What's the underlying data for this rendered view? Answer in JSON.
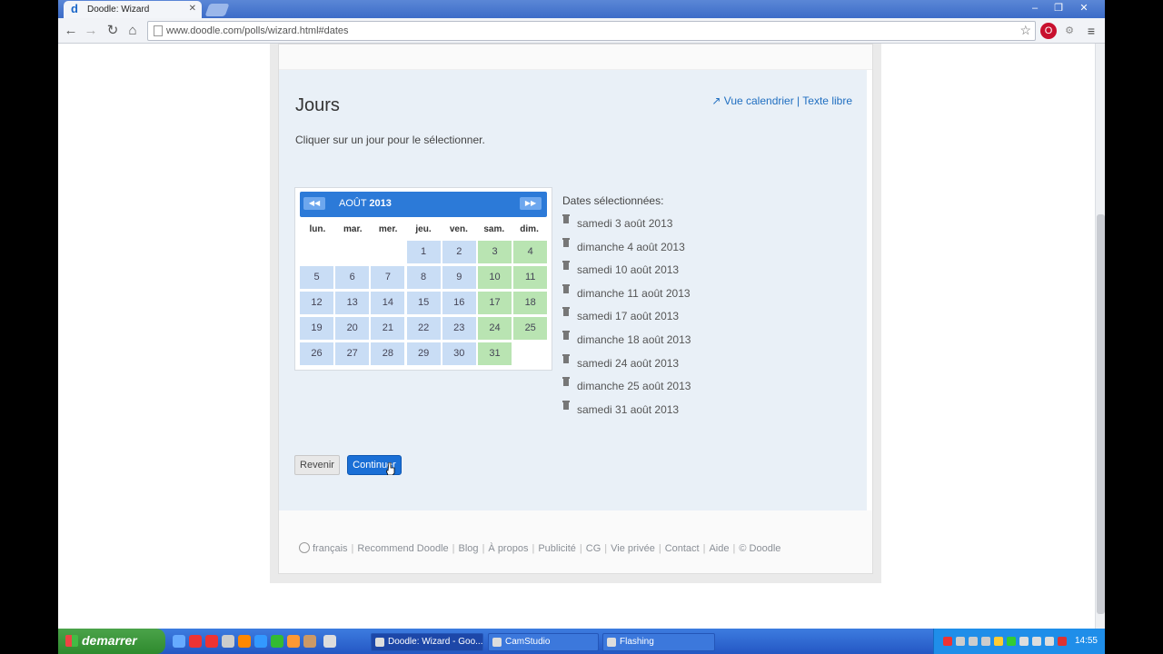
{
  "browser": {
    "tab_title": "Doodle: Wizard",
    "tab_favicon": "d",
    "url": "www.doodle.com/polls/wizard.html#dates",
    "window_controls": [
      "minimize-icon",
      "restore-icon",
      "close-icon"
    ]
  },
  "wizard": {
    "title": "Jours",
    "link_calendar": "Vue calendrier",
    "link_separator": "|",
    "link_text": "Texte libre",
    "instructions": "Cliquer sur un jour pour le sélectionner.",
    "calendar": {
      "month": "AOÛT",
      "year": "2013",
      "weekdays": [
        "lun.",
        "mar.",
        "mer.",
        "jeu.",
        "ven.",
        "sam.",
        "dim."
      ],
      "rows": [
        [
          null,
          null,
          null,
          1,
          2,
          3,
          4
        ],
        [
          5,
          6,
          7,
          8,
          9,
          10,
          11
        ],
        [
          12,
          13,
          14,
          15,
          16,
          17,
          18
        ],
        [
          19,
          20,
          21,
          22,
          23,
          24,
          25
        ],
        [
          26,
          27,
          28,
          29,
          30,
          31,
          null
        ]
      ],
      "selected_days": [
        3,
        4,
        10,
        11,
        17,
        18,
        24,
        25,
        31
      ],
      "colors": {
        "header": "#2c7ad8",
        "day": "#c9ddf5",
        "selected_day": "#b9e4b2"
      }
    },
    "selected_title": "Dates sélectionnées:",
    "selected_dates": [
      "samedi 3 août 2013",
      "dimanche 4 août 2013",
      "samedi 10 août 2013",
      "dimanche 11 août 2013",
      "samedi 17 août 2013",
      "dimanche 18 août 2013",
      "samedi 24 août 2013",
      "dimanche 25 août 2013",
      "samedi 31 août 2013"
    ],
    "back_label": "Revenir",
    "continue_label": "Continuer"
  },
  "footer": {
    "links": [
      "français",
      "Recommend Doodle",
      "Blog",
      "À propos",
      "Publicité",
      "CG",
      "Vie privée",
      "Contact",
      "Aide",
      "© Doodle"
    ]
  },
  "taskbar": {
    "start_label": "demarrer",
    "tasks": [
      {
        "label": "Doodle: Wizard - Goo...",
        "active": true
      },
      {
        "label": "CamStudio",
        "active": false
      },
      {
        "label": "Flashing",
        "active": false
      }
    ],
    "clock": "14:55"
  }
}
